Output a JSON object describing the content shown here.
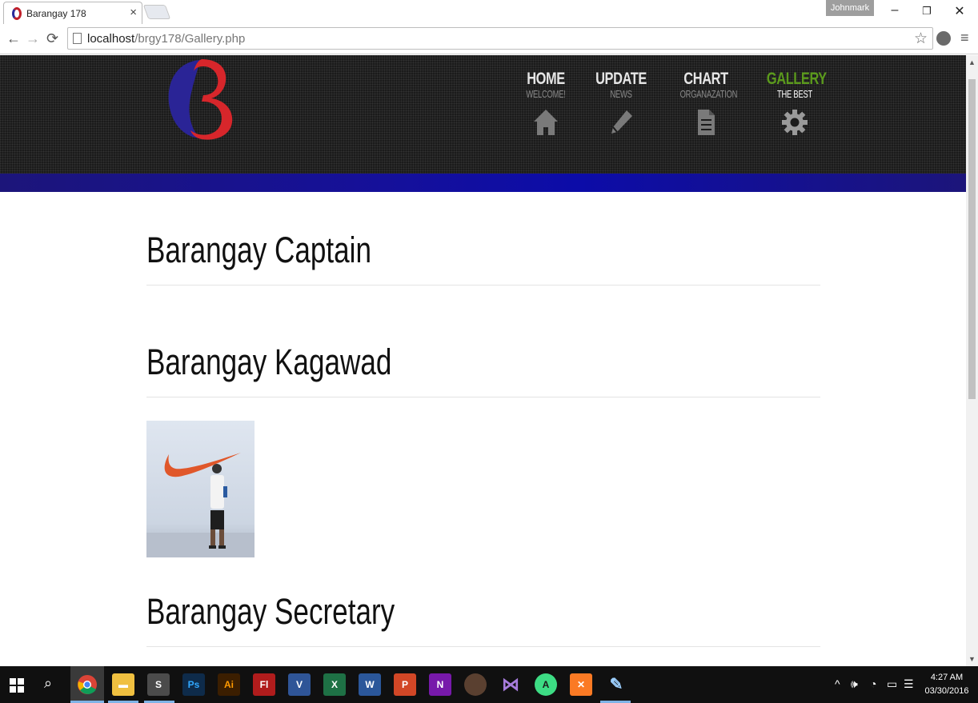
{
  "browser": {
    "tab_title": "Barangay 178",
    "tab_close": "×",
    "profile": "Johnmark",
    "url_host": "localhost",
    "url_path": "/brgy178/Gallery.php",
    "window_controls": {
      "minimize": "–",
      "restore": "❐",
      "close": "✕"
    }
  },
  "nav": [
    {
      "title": "HOME",
      "subtitle": "WELCOME!",
      "icon": "home-icon",
      "active": false
    },
    {
      "title": "UPDATE",
      "subtitle": "NEWS",
      "icon": "pencil-icon",
      "active": false
    },
    {
      "title": "CHART",
      "subtitle": "ORGANAZATION",
      "icon": "document-icon",
      "active": false
    },
    {
      "title": "GALLERY",
      "subtitle": "THE BEST",
      "icon": "gear-icon",
      "active": true
    }
  ],
  "sections": [
    {
      "title": "Barangay Captain"
    },
    {
      "title": "Barangay Kagawad"
    },
    {
      "title": "Barangay Secretary"
    }
  ],
  "taskbar": {
    "apps": [
      "chrome-icon",
      "file-explorer-icon",
      "sublime-icon",
      "photoshop-icon",
      "illustrator-icon",
      "flash-icon",
      "visio-icon",
      "excel-icon",
      "word-icon",
      "powerpoint-icon",
      "onenote-icon",
      "person-icon",
      "visual-studio-icon",
      "android-studio-icon",
      "xampp-icon",
      "paint-icon"
    ],
    "app_labels": {
      "ps": "Ps",
      "ai": "Ai",
      "fl": "Fl",
      "v": "V",
      "x": "X",
      "w": "W",
      "p": "P",
      "n": "N"
    },
    "time": "4:27 AM",
    "date": "03/30/2016"
  },
  "colors": {
    "accent_active": "#5b9a1c",
    "band": "#15109a",
    "header_bg": "#1b1b1b"
  }
}
